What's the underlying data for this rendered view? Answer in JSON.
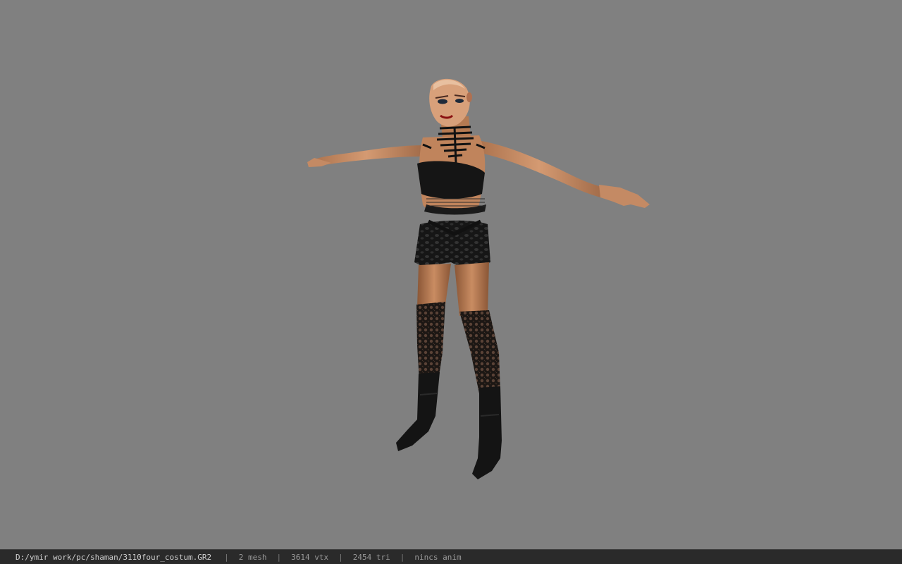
{
  "viewport": {
    "background": "#808080",
    "model_icon": "character-model-tpose"
  },
  "status_bar": {
    "file_path": "D:/ymir work/pc/shaman/3110four_costum.GR2",
    "separator": "|",
    "mesh_count": "2 mesh",
    "vertex_count": "3614 vtx",
    "triangle_count": "2454 tri",
    "animation": "nincs anim"
  }
}
